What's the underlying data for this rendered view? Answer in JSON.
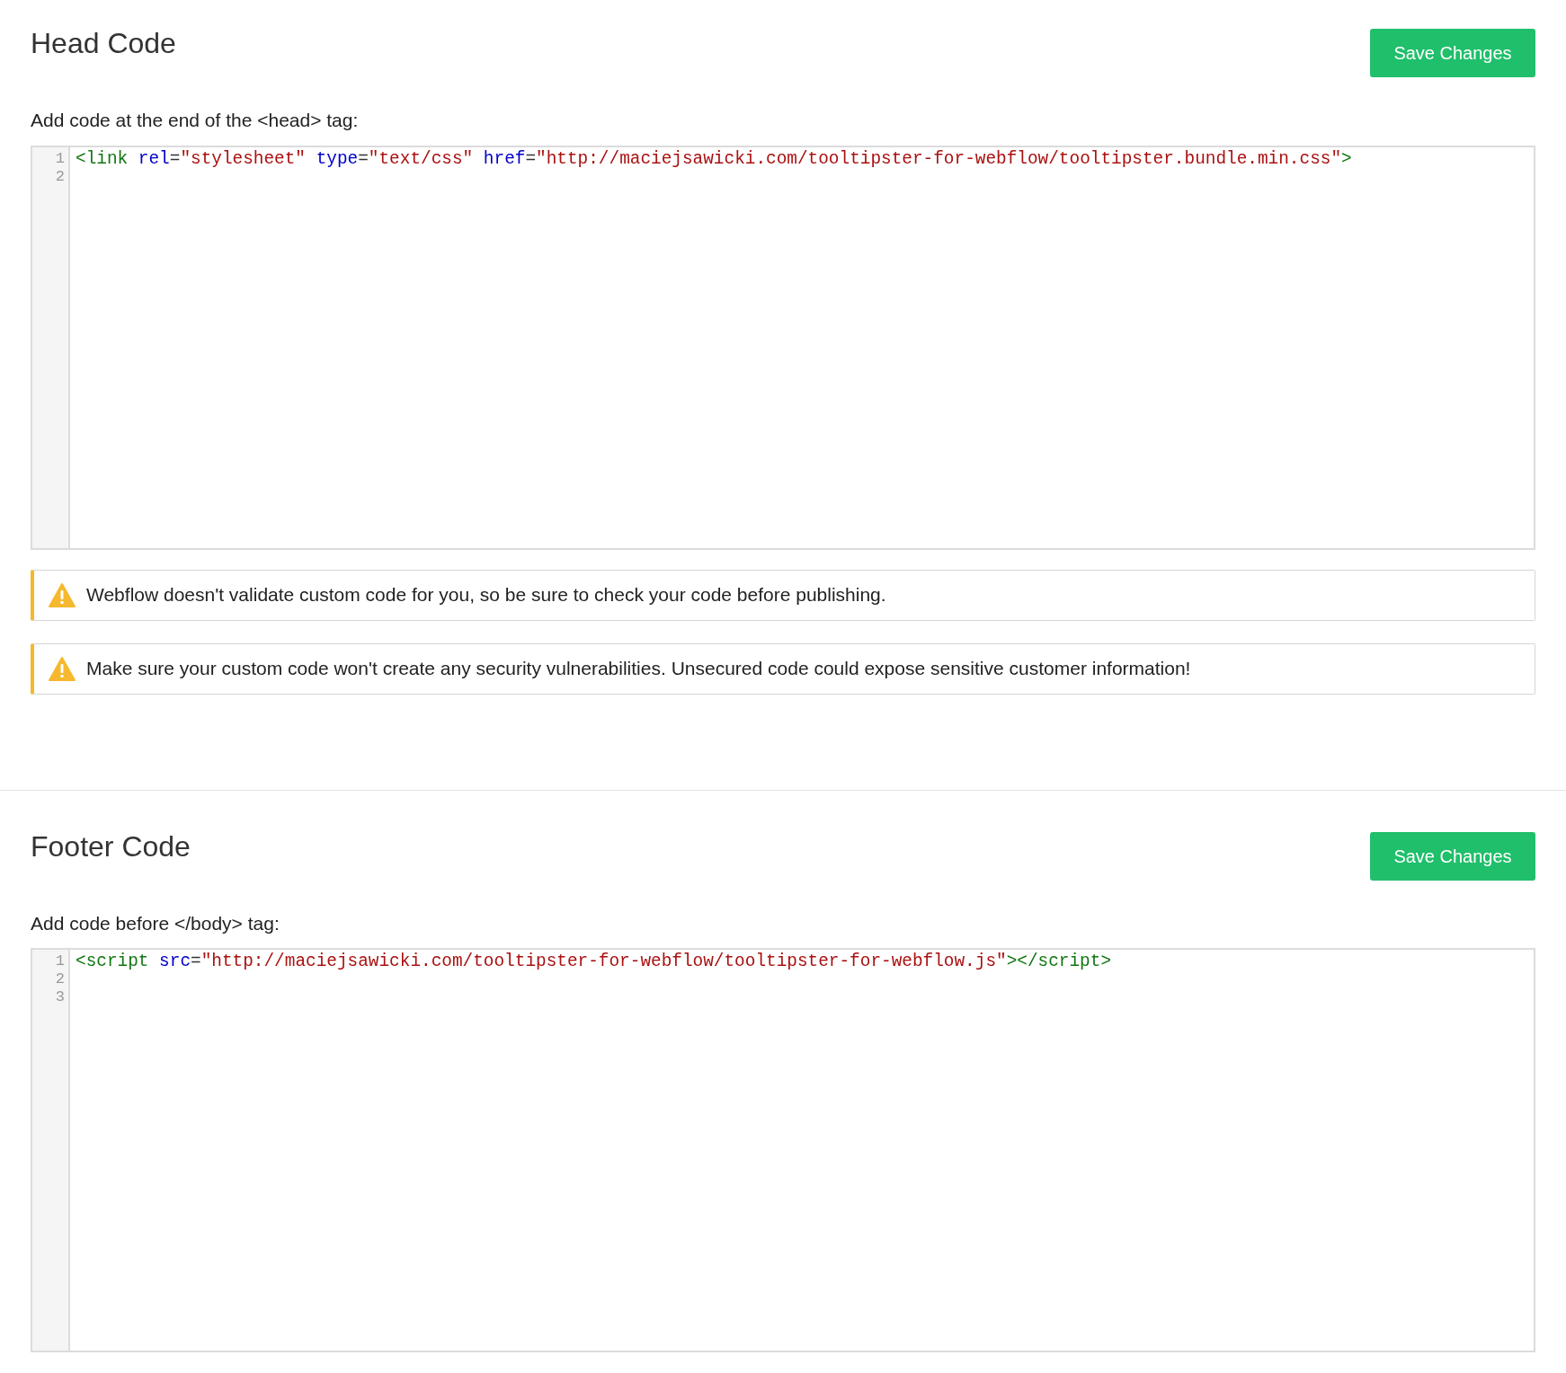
{
  "sections": [
    {
      "title": "Head Code",
      "button": "Save Changes",
      "label": "Add code at the end of the <head> tag:",
      "editor": {
        "lines": [
          {
            "number": "1",
            "tokens": [
              {
                "kind": "tag",
                "text": "<link"
              },
              {
                "kind": "attr",
                "text": " rel"
              },
              {
                "kind": "punct",
                "text": "="
              },
              {
                "kind": "string",
                "text": "\"stylesheet\""
              },
              {
                "kind": "attr",
                "text": " type"
              },
              {
                "kind": "punct",
                "text": "="
              },
              {
                "kind": "string",
                "text": "\"text/css\""
              },
              {
                "kind": "attr",
                "text": " href"
              },
              {
                "kind": "punct",
                "text": "="
              },
              {
                "kind": "string",
                "text": "\"http://maciejsawicki.com/tooltipster-for-webflow/tooltipster.bundle.min.css\""
              },
              {
                "kind": "tag",
                "text": ">"
              }
            ]
          },
          {
            "number": "2"
          }
        ]
      },
      "warnings": [
        "Webflow doesn't validate custom code for you, so be sure to check your code before publishing.",
        "Make sure your custom code won't create any security vulnerabilities. Unsecured code could expose sensitive customer information!"
      ]
    },
    {
      "title": "Footer Code",
      "button": "Save Changes",
      "label": "Add code before </body> tag:",
      "editor": {
        "lines": [
          {
            "number": "1",
            "tokens": [
              {
                "kind": "tag",
                "text": "<script"
              },
              {
                "kind": "attr",
                "text": " src"
              },
              {
                "kind": "punct",
                "text": "="
              },
              {
                "kind": "string",
                "text": "\"http://maciejsawicki.com/tooltipster-for-webflow/tooltipster-for-webflow.js\""
              },
              {
                "kind": "tag",
                "text": "></script>"
              }
            ]
          },
          {
            "number": "2"
          },
          {
            "number": "3"
          }
        ]
      }
    }
  ]
}
